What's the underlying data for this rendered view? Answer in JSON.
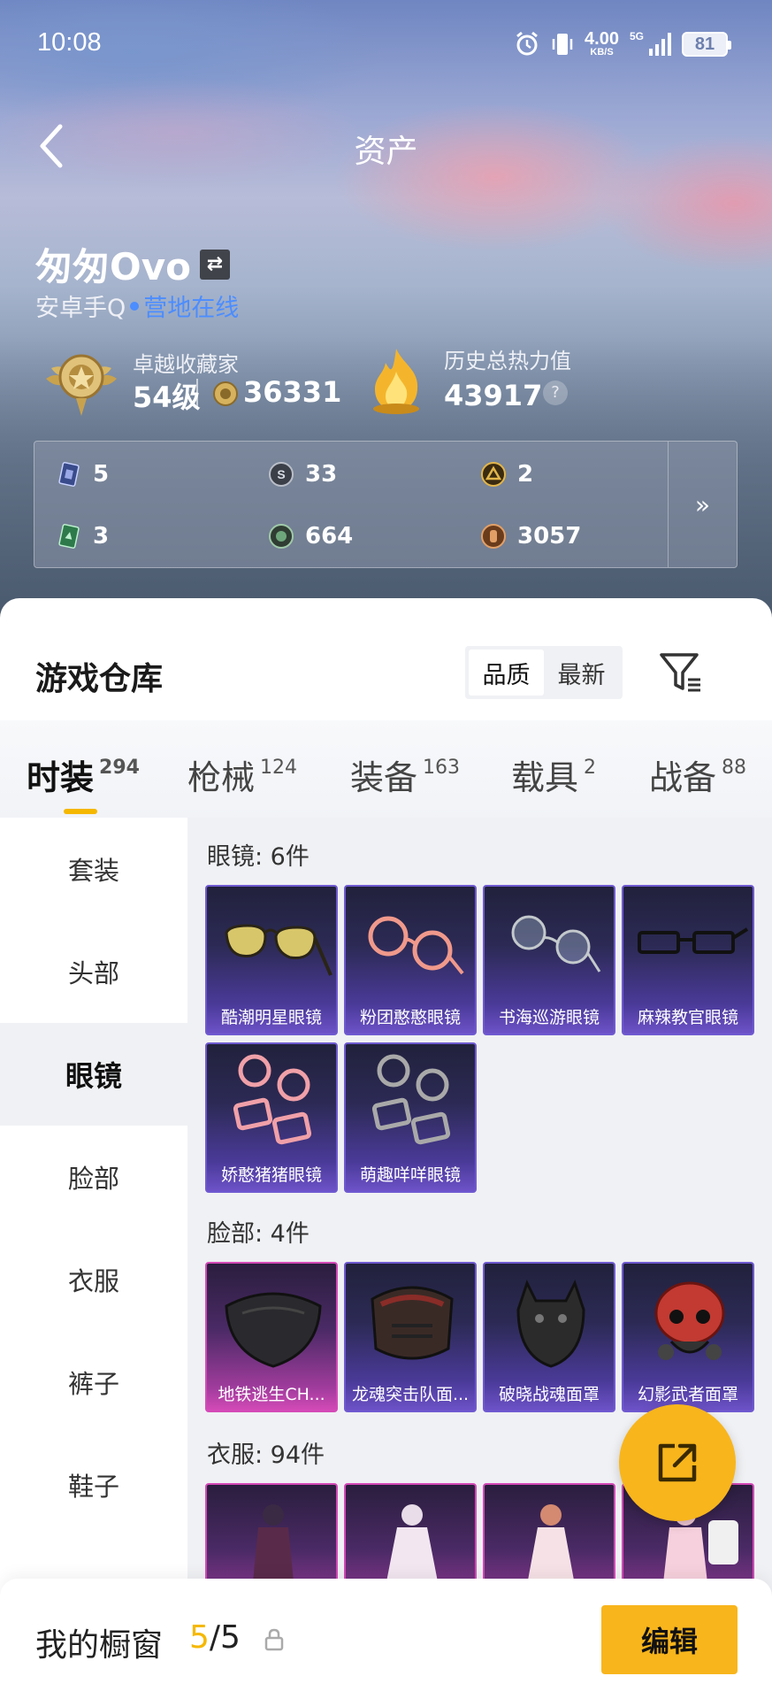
{
  "status_bar": {
    "time": "10:08",
    "speed_value": "4.00",
    "speed_unit": "KB/S",
    "network": "5G",
    "battery": "81"
  },
  "nav": {
    "title": "资产",
    "back_icon": "chevron-left-icon"
  },
  "player": {
    "name": "匆匆Ovo",
    "platform": "安卓手Q",
    "status": "营地在线"
  },
  "rank": {
    "title": "卓越收藏家",
    "level": "54级",
    "points": "36331"
  },
  "heat": {
    "title": "历史总热力值",
    "value": "43917",
    "help": "?"
  },
  "stats": [
    {
      "value": "5",
      "icon": "card-icon"
    },
    {
      "value": "33",
      "icon": "silver-coin-icon"
    },
    {
      "value": "2",
      "icon": "gold-emblem-icon"
    },
    {
      "value": "3",
      "icon": "green-card-icon"
    },
    {
      "value": "664",
      "icon": "green-coin-icon"
    },
    {
      "value": "3057",
      "icon": "bronze-coin-icon"
    }
  ],
  "stats_more": "»",
  "warehouse": {
    "title": "游戏仓库",
    "sort_options": [
      "品质",
      "最新"
    ],
    "sort_active": "品质"
  },
  "tabs": [
    {
      "label": "时装",
      "count": "294",
      "active": true
    },
    {
      "label": "枪械",
      "count": "124",
      "active": false
    },
    {
      "label": "装备",
      "count": "163",
      "active": false
    },
    {
      "label": "载具",
      "count": "2",
      "active": false
    },
    {
      "label": "战备",
      "count": "88",
      "active": false
    }
  ],
  "sidebar": [
    "套装",
    "头部",
    "眼镜",
    "脸部",
    "衣服",
    "裤子",
    "鞋子"
  ],
  "sidebar_active": "眼镜",
  "sections": [
    {
      "title": "眼镜: 6件",
      "items": [
        "酷潮明星眼镜",
        "粉团憨憨眼镜",
        "书海巡游眼镜",
        "麻辣教官眼镜",
        "娇憨猪猪眼镜",
        "萌趣咩咩眼镜"
      ]
    },
    {
      "title": "脸部: 4件",
      "items": [
        "地铁逃生CH...",
        "龙魂突击队面...",
        "破晓战魂面罩",
        "幻影武者面罩"
      ]
    },
    {
      "title": "衣服: 94件",
      "items": [
        "",
        "",
        "",
        ""
      ]
    }
  ],
  "bottom": {
    "label": "我的橱窗",
    "current": "5",
    "total": "/5",
    "edit": "编辑"
  },
  "colors": {
    "accent": "#f8b51c",
    "online": "#4c8dff",
    "rarity_purple": "#6f5ad0",
    "rarity_pink": "#d44ab7"
  }
}
